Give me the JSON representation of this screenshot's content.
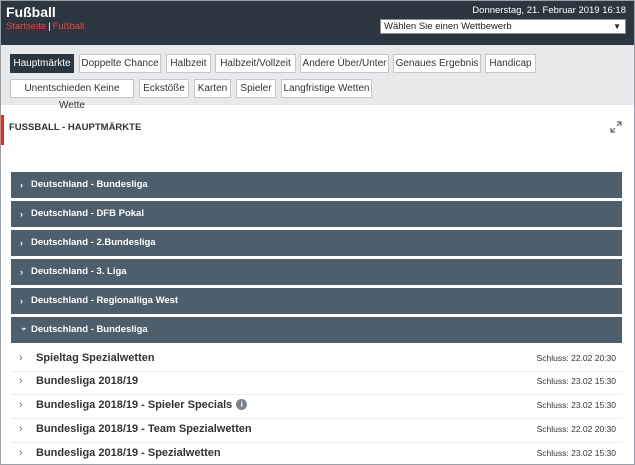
{
  "header": {
    "title": "Fußball",
    "breadcrumbs": [
      "Startseite",
      "Fußball"
    ],
    "breadcrumb_separator": "|",
    "datetime": "Donnerstag, 21. Februar 2019 16:18",
    "competition_select": {
      "value": "Wählen Sie einen Wettbewerb",
      "caret": "▼"
    }
  },
  "tabs": [
    {
      "label": "Hauptmärkte",
      "active": true
    },
    {
      "label": "Doppelte Chance",
      "active": false
    },
    {
      "label": "Halbzeit",
      "active": false
    },
    {
      "label": "Halbzeit/Vollzeit",
      "active": false
    },
    {
      "label": "Andere Über/Unter",
      "active": false
    },
    {
      "label": "Genaues Ergebnis",
      "active": false
    },
    {
      "label": "Handicap",
      "active": false
    },
    {
      "label": "Unentschieden Keine Wette",
      "active": false
    },
    {
      "label": "Eckstöße",
      "active": false
    },
    {
      "label": "Karten",
      "active": false
    },
    {
      "label": "Spieler",
      "active": false
    },
    {
      "label": "Langfristige Wetten",
      "active": false
    }
  ],
  "section": {
    "title": "FUSSBALL - HAUPTMÄRKTE"
  },
  "leagues": [
    {
      "label": "Deutschland - Bundesliga",
      "expanded": false,
      "chevron": "›"
    },
    {
      "label": "Deutschland - DFB Pokal",
      "expanded": false,
      "chevron": "›"
    },
    {
      "label": "Deutschland - 2.Bundesliga",
      "expanded": false,
      "chevron": "›"
    },
    {
      "label": "Deutschland - 3. Liga",
      "expanded": false,
      "chevron": "›"
    },
    {
      "label": "Deutschland - Regionalliga West",
      "expanded": false,
      "chevron": "›"
    },
    {
      "label": "Deutschland - Bundesliga",
      "expanded": true,
      "chevron": "⌄"
    }
  ],
  "markets": [
    {
      "label": "Spieltag Spezialwetten",
      "closing": "Schluss: 22.02 20:30",
      "info": false
    },
    {
      "label": "Bundesliga 2018/19",
      "closing": "Schluss: 23.02 15:30",
      "info": false
    },
    {
      "label": "Bundesliga 2018/19 - Spieler Specials",
      "closing": "Schluss: 23.02 15:30",
      "info": true
    },
    {
      "label": "Bundesliga 2018/19 - Team Spezialwetten",
      "closing": "Schluss: 22.02 20:30",
      "info": false
    },
    {
      "label": "Bundesliga 2018/19 - Spezialwetten",
      "closing": "Schluss: 23.02 15:30",
      "info": false
    }
  ],
  "colors": {
    "header_bg": "#2b3640",
    "accent_red": "#d3352a",
    "league_bar": "#4d5e6c",
    "tab_area": "#e7e9eb"
  }
}
